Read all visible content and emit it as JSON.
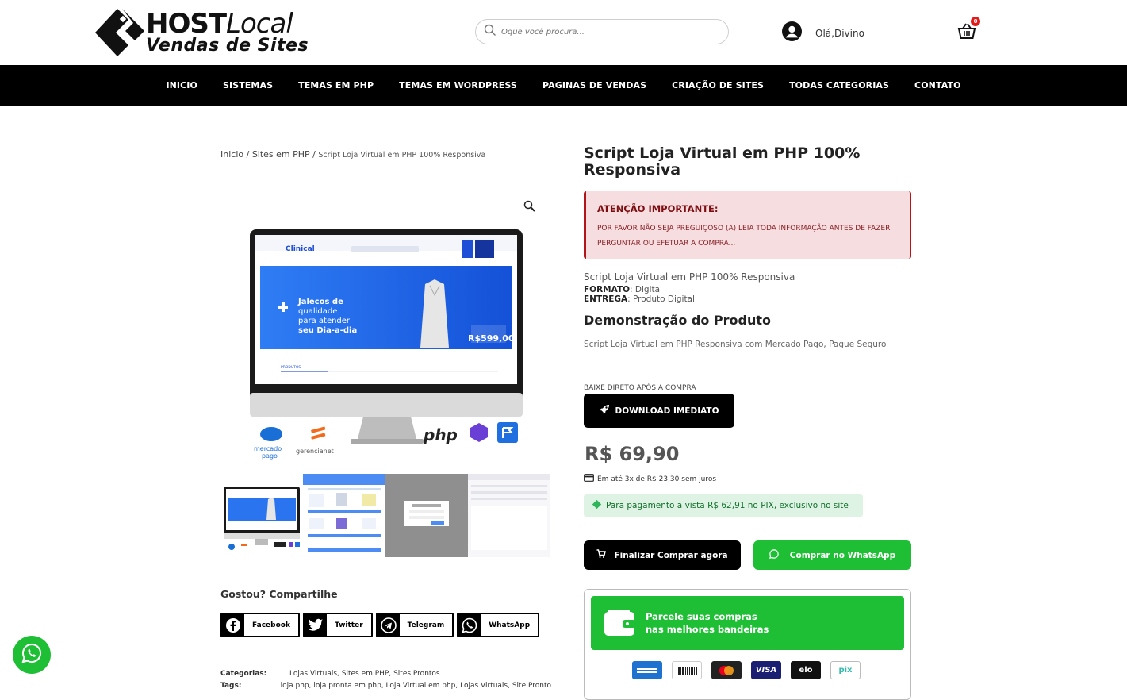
{
  "header": {
    "logo_line1_a": "HOST",
    "logo_line1_b": "Local",
    "logo_line2": "Vendas de Sites",
    "search_placeholder": "Oque você procura...",
    "account_label": "Olá,Divino",
    "cart_count": "0"
  },
  "nav": {
    "items": [
      "INICIO",
      "SISTEMAS",
      "TEMAS EM PHP",
      "TEMAS EM WORDPRESS",
      "PAGINAS DE VENDAS",
      "CRIAÇÃO DE SITES",
      "TODAS CATEGORIAS",
      "CONTATO"
    ]
  },
  "breadcrumb": {
    "home": "Inicio",
    "sep": " / ",
    "category": "Sites em PHP",
    "current": "Script Loja Virtual em PHP 100% Responsiva"
  },
  "gallery": {
    "brand": "Clinical",
    "hero_line1": "Jalecos de",
    "hero_line2": "qualidade",
    "hero_line3": "para atender",
    "hero_line4": "seu Dia-a-dia",
    "price_tag": "R$599,00",
    "section_label": "PRODUTOS",
    "logo_mercadopago_a": "mercado",
    "logo_mercadopago_b": "pago",
    "logo_gerencianet": "gerencianet",
    "logo_php": "php"
  },
  "share": {
    "title": "Gostou? Compartilhe",
    "buttons": [
      "Facebook",
      "Twitter",
      "Telegram",
      "WhatsApp"
    ]
  },
  "meta": {
    "categories_key": "Categorias:",
    "categories_value": "Lojas Virtuais, Sites em PHP, Sites Prontos",
    "tags_key": "Tags:",
    "tags_value": "loja php, loja pronta em php, Loja Virtual em php, Lojas Virtuais, Site Pronto"
  },
  "product": {
    "title": "Script Loja Virtual em PHP 100% Responsiva",
    "alert_title": "ATENÇÃO IMPORTANTE:",
    "alert_text": "POR FAVOR NÃO SEJA PREGUIÇOSO (A) LEIA TODA INFORMAÇÃO ANTES DE FAZER PERGUNTAR OU EFETUAR A COMPRA...",
    "subtitle": "Script Loja Virtual em PHP 100% Responsiva",
    "format_key": "FORMATO",
    "format_value": ": Digital",
    "delivery_key": "ENTREGA",
    "delivery_value": ": Produto Digital",
    "demo_title": "Demonstração do Produto",
    "demo_text": "Script Loja Virtual em PHP Responsiva com Mercado Pago, Pague Seguro",
    "download_pre": "BAIXE DIRETO APÓS A COMPRA",
    "download_label": "DOWNLOAD IMEDIATO",
    "price": "R$ 69,90",
    "installments_pre": "Em até 3x de ",
    "installments_value": "R$ 23,30",
    "installments_post": " sem juros",
    "pix_text": "Para pagamento a vista R$ 62,91 no PIX, exclusivo no site",
    "buy_label": "Finalizar Comprar agora",
    "whatsapp_label": "Comprar no WhatsApp",
    "installment_card_line1": "Parcele suas compras",
    "installment_card_line2": "nas melhores bandeiras",
    "card_brands": [
      "AMERICAN EXPRESS",
      "BOLETO",
      "MASTERCARD",
      "VISA",
      "ELO",
      "PIX"
    ],
    "card_visa": "VISA",
    "card_elo": "elo",
    "card_pix": "pix"
  },
  "colors": {
    "nav_bg": "#000000",
    "alert_bg": "#f6dde0",
    "alert_border": "#b31419",
    "green": "#1fbf35",
    "pix_bg": "#dff3e5",
    "cart_badge": "#e21b1b"
  }
}
